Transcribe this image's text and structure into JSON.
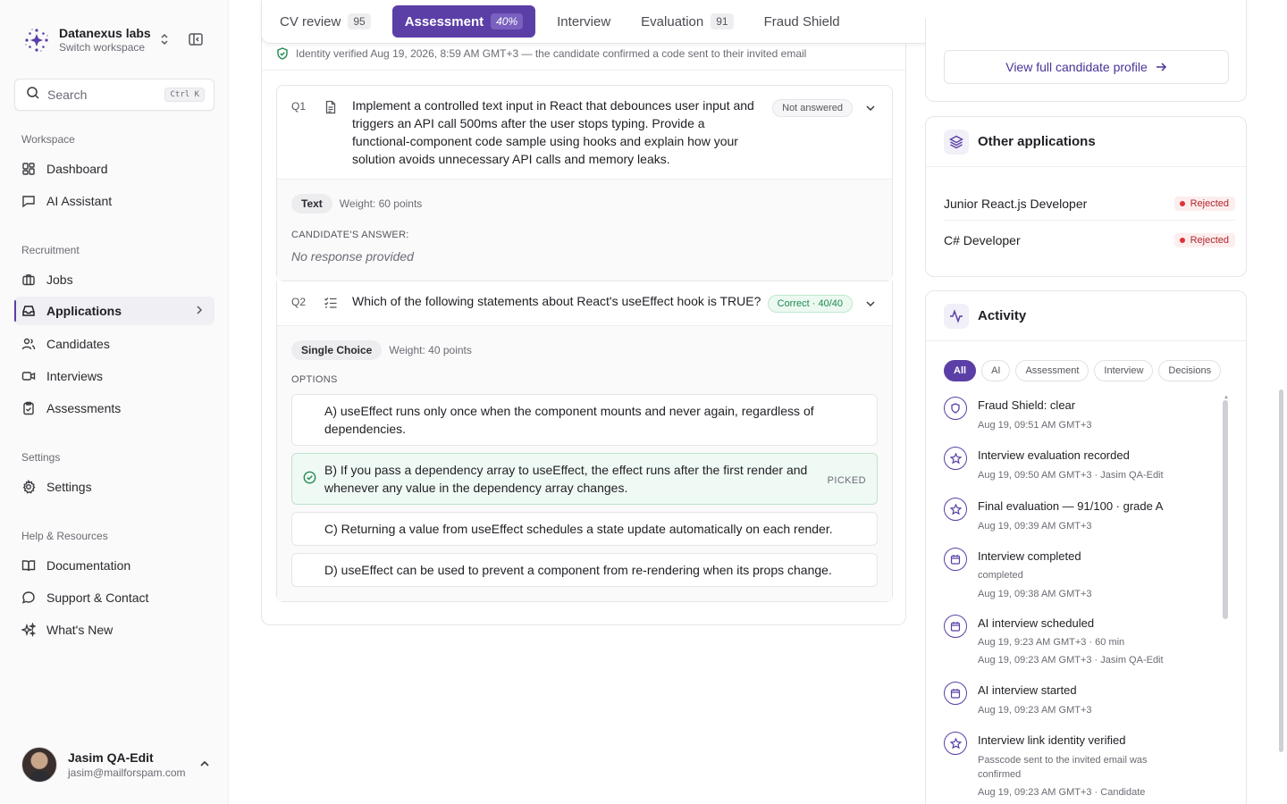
{
  "workspace": {
    "name": "Datanexus labs",
    "subtitle": "Switch workspace"
  },
  "search": {
    "placeholder": "Search",
    "shortcut": "Ctrl K"
  },
  "sidebar": {
    "sections": [
      {
        "label": "Workspace"
      },
      {
        "label": "Recruitment"
      },
      {
        "label": "Settings"
      },
      {
        "label": "Help & Resources"
      }
    ],
    "items": [
      {
        "label": "Dashboard",
        "icon": "grid-icon"
      },
      {
        "label": "AI Assistant",
        "icon": "chat-icon"
      },
      {
        "label": "Jobs",
        "icon": "briefcase-icon"
      },
      {
        "label": "Applications",
        "icon": "inbox-icon",
        "active": true
      },
      {
        "label": "Candidates",
        "icon": "users-icon"
      },
      {
        "label": "Interviews",
        "icon": "video-icon"
      },
      {
        "label": "Assessments",
        "icon": "clipboard-icon"
      },
      {
        "label": "Settings",
        "icon": "gear-icon"
      },
      {
        "label": "Documentation",
        "icon": "book-icon"
      },
      {
        "label": "Support & Contact",
        "icon": "message-icon"
      },
      {
        "label": "What's New",
        "icon": "sparkles-icon"
      }
    ]
  },
  "user": {
    "name": "Jasim QA-Edit",
    "email": "jasim@mailforspam.com"
  },
  "tabs": [
    {
      "label": "CV review",
      "count": "95"
    },
    {
      "label": "Assessment",
      "count": "40%",
      "active": true
    },
    {
      "label": "Interview",
      "count": ""
    },
    {
      "label": "Evaluation",
      "count": "91"
    },
    {
      "label": "Fraud Shield",
      "count": ""
    }
  ],
  "assessment": {
    "verified_text": "Identity verified Aug 19, 2026, 8:59 AM GMT+3 — the candidate confirmed a code sent to their invited email",
    "q1": {
      "number": "Q1",
      "text": "Implement a controlled text input in React that debounces user input and triggers an API call 500ms after the user stops typing. Provide a functional-component code sample using hooks and explain how your solution avoids unnecessary API calls and memory leaks.",
      "status": "Not answered",
      "type": "Text",
      "weight": "Weight: 60 points",
      "answer_label": "CANDIDATE'S ANSWER:",
      "answer": "No response provided"
    },
    "q2": {
      "number": "Q2",
      "text": "Which of the following statements about React's useEffect hook is TRUE?",
      "status": "Correct · 40/40",
      "type": "Single Choice",
      "weight": "Weight: 40 points",
      "options_label": "OPTIONS",
      "picked_label": "PICKED",
      "options": [
        {
          "text": "A) useEffect runs only once when the component mounts and never again, regardless of dependencies."
        },
        {
          "text": "B) If you pass a dependency array to useEffect, the effect runs after the first render and whenever any value in the dependency array changes.",
          "picked": true
        },
        {
          "text": "C) Returning a value from useEffect schedules a state update automatically on each render."
        },
        {
          "text": "D) useEffect can be used to prevent a component from re-rendering when its props change."
        }
      ]
    }
  },
  "profile": {
    "button_label": "View full candidate profile"
  },
  "other_applications": {
    "title": "Other applications",
    "items": [
      {
        "title": "Junior React.js Developer",
        "status": "Rejected"
      },
      {
        "title": "C# Developer",
        "status": "Rejected"
      }
    ]
  },
  "activity": {
    "title": "Activity",
    "filters": [
      "All",
      "AI",
      "Assessment",
      "Interview",
      "Decisions"
    ],
    "items": [
      {
        "title": "Fraud Shield: clear",
        "lines": [
          "Aug 19, 09:51 AM GMT+3"
        ],
        "icon": "shield-icon"
      },
      {
        "title": "Interview evaluation recorded",
        "lines": [
          "Aug 19, 09:50 AM GMT+3 · Jasim QA-Edit"
        ],
        "icon": "star-icon"
      },
      {
        "title": "Final evaluation — 91/100 · grade A",
        "lines": [
          "Aug 19, 09:39 AM GMT+3"
        ],
        "icon": "star-icon"
      },
      {
        "title": "Interview completed",
        "lines": [
          "completed",
          "Aug 19, 09:38 AM GMT+3"
        ],
        "icon": "calendar-icon"
      },
      {
        "title": "AI interview scheduled",
        "lines": [
          "Aug 19, 9:23 AM GMT+3 · 60 min",
          "Aug 19, 09:23 AM GMT+3 · Jasim QA-Edit"
        ],
        "icon": "calendar-icon"
      },
      {
        "title": "AI interview started",
        "lines": [
          "Aug 19, 09:23 AM GMT+3"
        ],
        "icon": "calendar-icon"
      },
      {
        "title": "Interview link identity verified",
        "lines": [
          "Passcode sent to the invited email was",
          "confirmed",
          "Aug 19, 09:23 AM GMT+3 · Candidate"
        ],
        "icon": "star-icon"
      }
    ]
  },
  "colors": {
    "accent": "#5b3fa6",
    "success": "#1e8a4f",
    "danger": "#e03139"
  }
}
